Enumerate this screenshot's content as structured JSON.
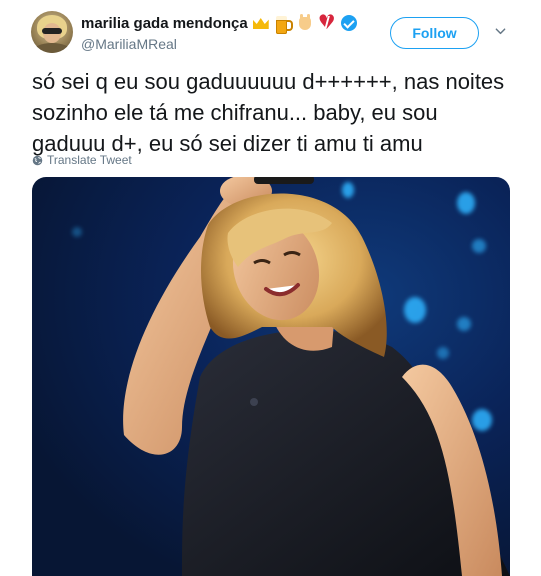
{
  "user": {
    "display_name": "marilia gada mendonça",
    "handle": "@MariliaMReal",
    "verified": true,
    "name_emojis": [
      "crown-emoji",
      "beer-emoji",
      "rock-hand-emoji",
      "broken-heart-emoji"
    ]
  },
  "actions": {
    "follow_label": "Follow",
    "caret_icon": "chevron-down-icon"
  },
  "tweet": {
    "text": "só sei q eu sou gaduuuuuu d++++++, nas noites sozinho ele tá me chifranu... baby, eu sou gaduuu d+, eu só sei dizer ti amu ti amu",
    "translate_label": "Translate Tweet"
  },
  "colors": {
    "accent": "#1da1f2",
    "text": "#14171a",
    "muted": "#657786"
  }
}
